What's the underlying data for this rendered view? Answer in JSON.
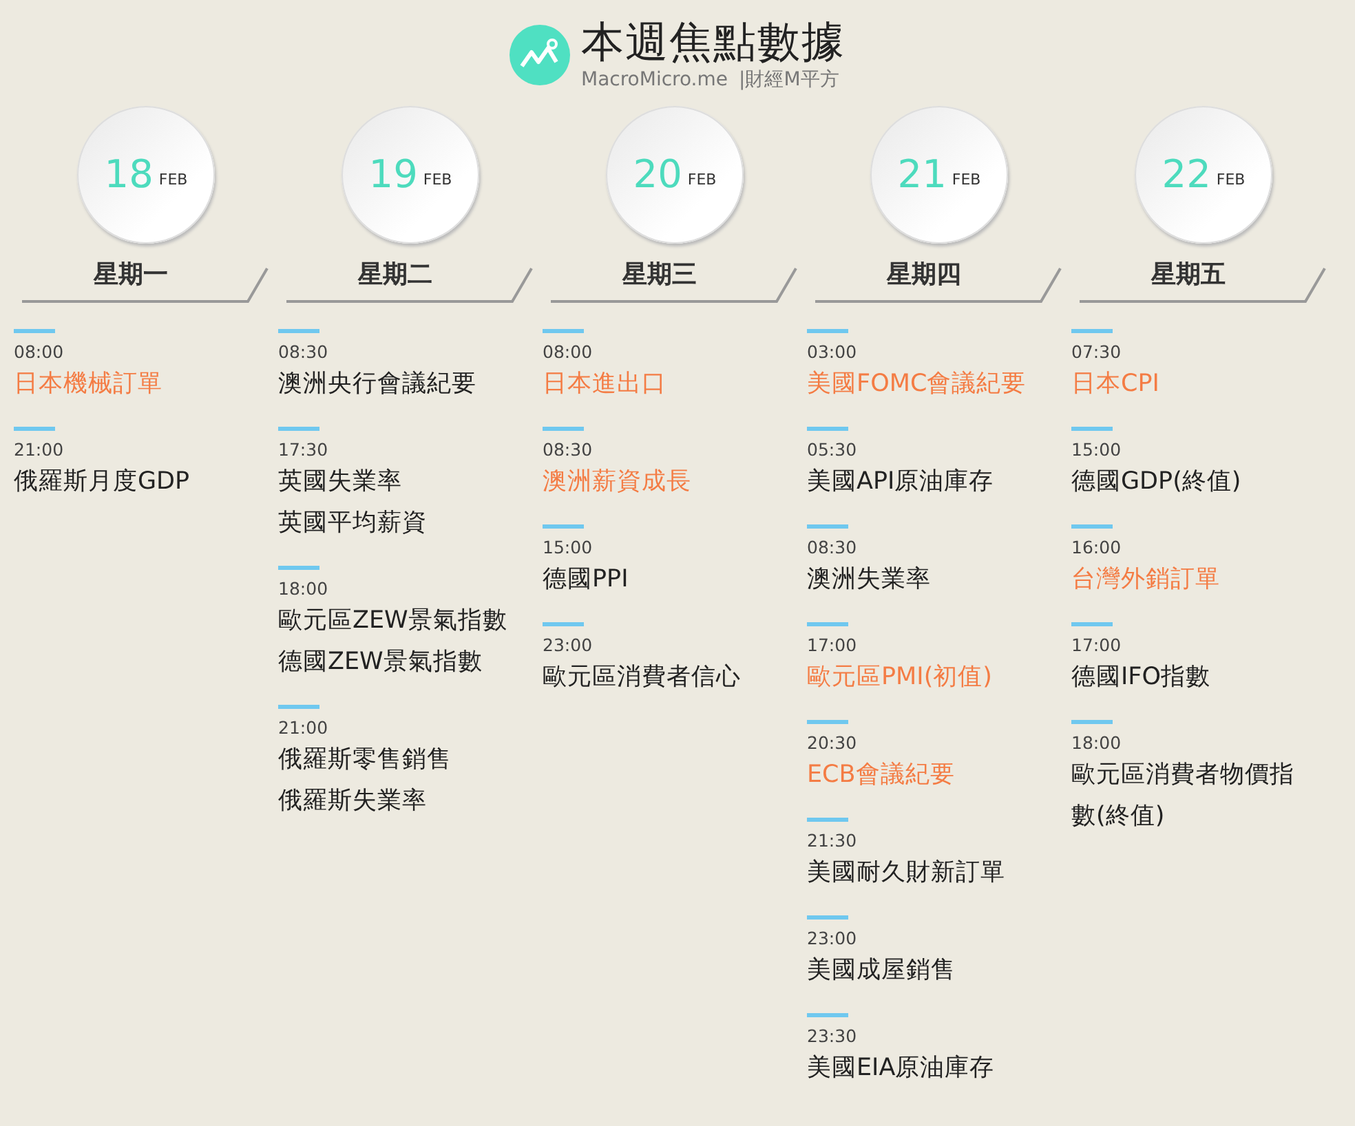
{
  "header": {
    "title": "本週焦點數據",
    "site": "MacroMicro.me",
    "brand": "|財經M平方"
  },
  "days": [
    {
      "day": "18",
      "month": "FEB",
      "weekday": "星期一",
      "events": [
        {
          "time": "08:00",
          "items": [
            {
              "name": "日本機械訂單",
              "highlight": true
            }
          ]
        },
        {
          "time": "21:00",
          "items": [
            {
              "name": "俄羅斯月度GDP",
              "highlight": false
            }
          ]
        }
      ]
    },
    {
      "day": "19",
      "month": "FEB",
      "weekday": "星期二",
      "events": [
        {
          "time": "08:30",
          "items": [
            {
              "name": "澳洲央行會議紀要",
              "highlight": false
            }
          ]
        },
        {
          "time": "17:30",
          "items": [
            {
              "name": "英國失業率",
              "highlight": false
            },
            {
              "name": "英國平均薪資",
              "highlight": false
            }
          ]
        },
        {
          "time": "18:00",
          "items": [
            {
              "name": "歐元區ZEW景氣指數",
              "highlight": false
            },
            {
              "name": "德國ZEW景氣指數",
              "highlight": false
            }
          ]
        },
        {
          "time": "21:00",
          "items": [
            {
              "name": "俄羅斯零售銷售",
              "highlight": false
            },
            {
              "name": "俄羅斯失業率",
              "highlight": false
            }
          ]
        }
      ]
    },
    {
      "day": "20",
      "month": "FEB",
      "weekday": "星期三",
      "events": [
        {
          "time": "08:00",
          "items": [
            {
              "name": "日本進出口",
              "highlight": true
            }
          ]
        },
        {
          "time": "08:30",
          "items": [
            {
              "name": "澳洲薪資成長",
              "highlight": true
            }
          ]
        },
        {
          "time": "15:00",
          "items": [
            {
              "name": "德國PPI",
              "highlight": false
            }
          ]
        },
        {
          "time": "23:00",
          "items": [
            {
              "name": "歐元區消費者信心",
              "highlight": false
            }
          ]
        }
      ]
    },
    {
      "day": "21",
      "month": "FEB",
      "weekday": "星期四",
      "events": [
        {
          "time": "03:00",
          "items": [
            {
              "name": "美國FOMC會議紀要",
              "highlight": true
            }
          ]
        },
        {
          "time": "05:30",
          "items": [
            {
              "name": "美國API原油庫存",
              "highlight": false
            }
          ]
        },
        {
          "time": "08:30",
          "items": [
            {
              "name": "澳洲失業率",
              "highlight": false
            }
          ]
        },
        {
          "time": "17:00",
          "items": [
            {
              "name": "歐元區PMI(初值)",
              "highlight": true
            }
          ]
        },
        {
          "time": "20:30",
          "items": [
            {
              "name": "ECB會議紀要",
              "highlight": true
            }
          ]
        },
        {
          "time": "21:30",
          "items": [
            {
              "name": "美國耐久財新訂單",
              "highlight": false
            }
          ]
        },
        {
          "time": "23:00",
          "items": [
            {
              "name": "美國成屋銷售",
              "highlight": false
            }
          ]
        },
        {
          "time": "23:30",
          "items": [
            {
              "name": "美國EIA原油庫存",
              "highlight": false
            }
          ]
        }
      ]
    },
    {
      "day": "22",
      "month": "FEB",
      "weekday": "星期五",
      "events": [
        {
          "time": "07:30",
          "items": [
            {
              "name": "日本CPI",
              "highlight": true
            }
          ]
        },
        {
          "time": "15:00",
          "items": [
            {
              "name": "德國GDP(終值)",
              "highlight": false
            }
          ]
        },
        {
          "time": "16:00",
          "items": [
            {
              "name": "台灣外銷訂單",
              "highlight": true
            }
          ]
        },
        {
          "time": "17:00",
          "items": [
            {
              "name": "德國IFO指數",
              "highlight": false
            }
          ]
        },
        {
          "time": "18:00",
          "items": [
            {
              "name": "歐元區消費者物價指數(終值)",
              "highlight": false
            }
          ]
        }
      ]
    }
  ]
}
